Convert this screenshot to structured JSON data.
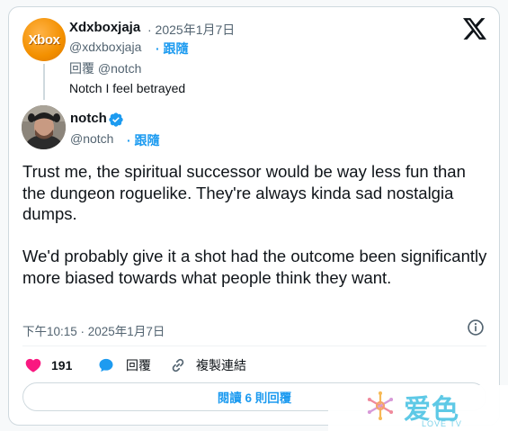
{
  "parent": {
    "avatar_text": "Xbox",
    "display_name": "Xdxboxjaja",
    "date": "· 2025年1月7日",
    "handle": "@xdxboxjaja",
    "follow_label": "· 跟隨",
    "replying_to": "回覆 @notch",
    "text": "Notch I feel betrayed"
  },
  "tweet": {
    "display_name": "notch",
    "verified": true,
    "handle": "@notch",
    "follow_label": "· 跟隨",
    "paragraphs": [
      "Trust me, the spiritual successor would be way less fun than the dungeon roguelike. They're always kinda sad nostalgia dumps.",
      "We'd probably give it a shot had the outcome been significantly more biased towards what people think they want."
    ],
    "timestamp": "下午10:15 · 2025年1月7日"
  },
  "actions": {
    "like_count": "191",
    "reply_label": "回覆",
    "copy_link_label": "複製連結"
  },
  "read_replies_label": "閱讀 6 則回覆",
  "watermark": {
    "main": "爱色",
    "sub": "LOVE TV"
  },
  "colors": {
    "accent": "#1d9bf0",
    "like": "#f91880",
    "text": "#0f1419",
    "muted": "#536471",
    "border": "#cfd9de"
  },
  "icons": [
    "x-logo-icon",
    "verified-badge-icon",
    "info-icon",
    "heart-icon",
    "reply-bubble-icon",
    "link-icon"
  ]
}
